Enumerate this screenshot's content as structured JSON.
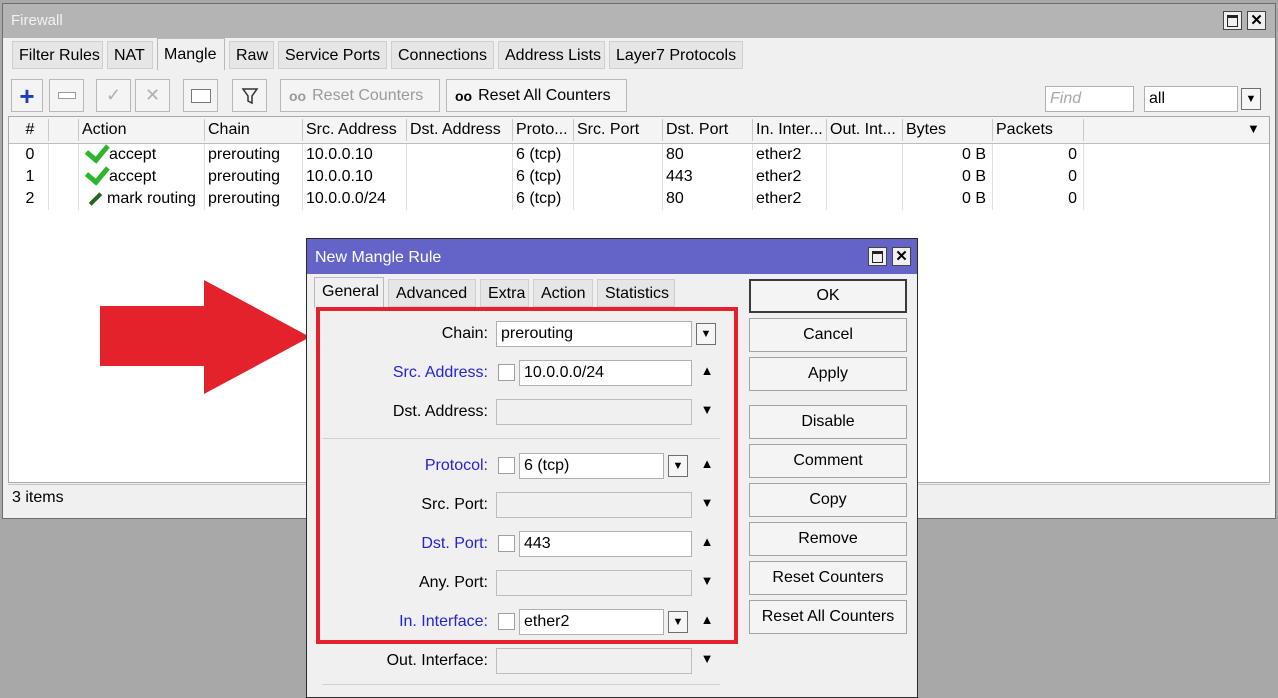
{
  "firewall": {
    "title": "Firewall",
    "tabs": [
      "Filter Rules",
      "NAT",
      "Mangle",
      "Raw",
      "Service Ports",
      "Connections",
      "Address Lists",
      "Layer7 Protocols"
    ],
    "active_tab": "Mangle",
    "toolbar": {
      "reset_counters": "Reset Counters",
      "reset_all_counters": "Reset All Counters",
      "find_placeholder": "Find",
      "filter_value": "all"
    },
    "columns": [
      "#",
      "Action",
      "Chain",
      "Src. Address",
      "Dst. Address",
      "Proto...",
      "Src. Port",
      "Dst. Port",
      "In. Inter...",
      "Out. Int...",
      "Bytes",
      "Packets"
    ],
    "rows": [
      {
        "num": "0",
        "action": "accept",
        "chain": "prerouting",
        "src": "10.0.0.10",
        "dst": "",
        "proto": "6 (tcp)",
        "sport": "",
        "dport": "80",
        "in_if": "ether2",
        "out_if": "",
        "bytes": "0 B",
        "packets": "0"
      },
      {
        "num": "1",
        "action": "accept",
        "chain": "prerouting",
        "src": "10.0.0.10",
        "dst": "",
        "proto": "6 (tcp)",
        "sport": "",
        "dport": "443",
        "in_if": "ether2",
        "out_if": "",
        "bytes": "0 B",
        "packets": "0"
      },
      {
        "num": "2",
        "action": "mark routing",
        "chain": "prerouting",
        "src": "10.0.0.0/24",
        "dst": "",
        "proto": "6 (tcp)",
        "sport": "",
        "dport": "80",
        "in_if": "ether2",
        "out_if": "",
        "bytes": "0 B",
        "packets": "0"
      }
    ],
    "status": "3 items"
  },
  "dialog": {
    "title": "New Mangle Rule",
    "tabs": [
      "General",
      "Advanced",
      "Extra",
      "Action",
      "Statistics"
    ],
    "active_tab": "General",
    "fields": {
      "chain": {
        "label": "Chain:",
        "value": "prerouting"
      },
      "src_address": {
        "label": "Src. Address:",
        "value": "10.0.0.0/24"
      },
      "dst_address": {
        "label": "Dst. Address:",
        "value": ""
      },
      "protocol": {
        "label": "Protocol:",
        "value": "6 (tcp)"
      },
      "src_port": {
        "label": "Src. Port:",
        "value": ""
      },
      "dst_port": {
        "label": "Dst. Port:",
        "value": "443"
      },
      "any_port": {
        "label": "Any. Port:",
        "value": ""
      },
      "in_interface": {
        "label": "In. Interface:",
        "value": "ether2"
      },
      "out_interface": {
        "label": "Out. Interface:",
        "value": ""
      }
    },
    "buttons": {
      "ok": "OK",
      "cancel": "Cancel",
      "apply": "Apply",
      "disable": "Disable",
      "comment": "Comment",
      "copy": "Copy",
      "remove": "Remove",
      "reset_counters": "Reset Counters",
      "reset_all_counters": "Reset All Counters"
    }
  },
  "colors": {
    "dialog_title": "#6464c8",
    "highlight_red": "#e4222b",
    "label_blue": "#2323d7",
    "check_green": "#2db52d"
  }
}
